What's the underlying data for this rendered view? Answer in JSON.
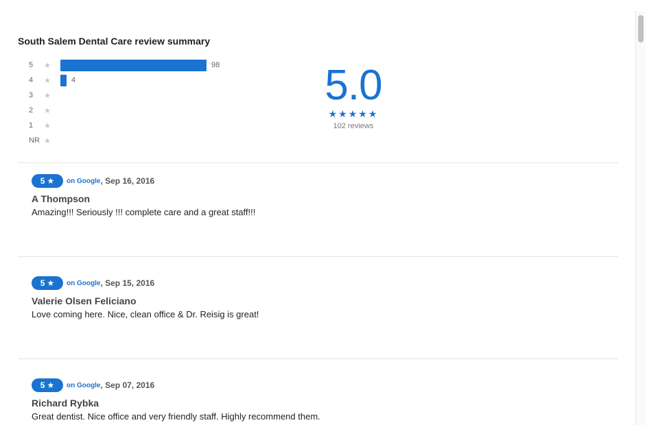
{
  "summary": {
    "title": "South Salem Dental Care review summary",
    "distribution": [
      {
        "label": "5",
        "count": 98,
        "count_text": "98"
      },
      {
        "label": "4",
        "count": 4,
        "count_text": "4"
      },
      {
        "label": "3",
        "count": 0,
        "count_text": ""
      },
      {
        "label": "2",
        "count": 0,
        "count_text": ""
      },
      {
        "label": "1",
        "count": 0,
        "count_text": ""
      },
      {
        "label": "NR",
        "count": 0,
        "count_text": ""
      }
    ],
    "overall_score": "5.0",
    "overall_stars": "★★★★★",
    "review_count": "102 reviews"
  },
  "reviews": [
    {
      "rating": "5",
      "source_prefix": "on Google",
      "date": ", Sep 16, 2016",
      "author": "A Thompson",
      "text": "Amazing!!! Seriously !!! complete care and a great staff!!!"
    },
    {
      "rating": "5",
      "source_prefix": "on Google",
      "date": ", Sep 15, 2016",
      "author": "Valerie Olsen Feliciano",
      "text": "Love coming here. Nice, clean office & Dr. Reisig is great!"
    },
    {
      "rating": "5",
      "source_prefix": "on Google",
      "date": ", Sep 07, 2016",
      "author": "Richard Rybka",
      "text": "Great dentist. Nice office and very friendly staff. Highly recommend them."
    }
  ],
  "colors": {
    "accent": "#1a73d0",
    "star_empty": "#c8c8c8"
  },
  "icons": {
    "star": "star-icon"
  }
}
